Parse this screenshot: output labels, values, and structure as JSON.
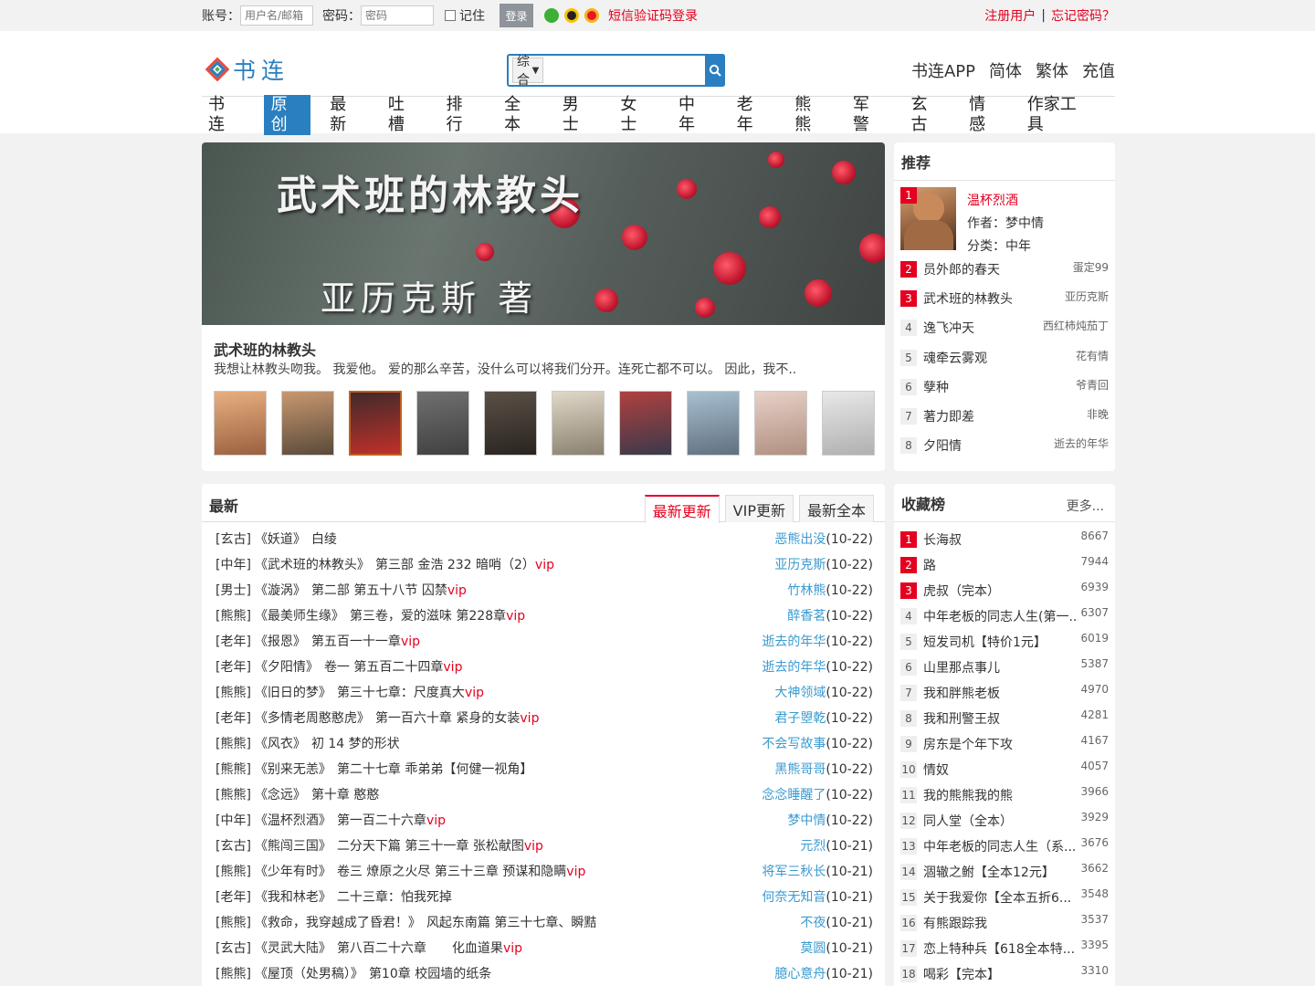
{
  "topbar": {
    "account_label": "账号：",
    "account_placeholder": "用户名/邮箱",
    "password_label": "密码：",
    "password_placeholder": "密码",
    "remember_label": "记住",
    "login_button": "登录",
    "sms_login": "短信验证码登录",
    "register": "注册用户",
    "separator": "|",
    "forgot": "忘记密码？"
  },
  "header": {
    "logo_text": "书连",
    "search_select": "综合",
    "links": [
      "书连APP",
      "简体",
      "繁体",
      "充值"
    ]
  },
  "nav": [
    "书连",
    "原创",
    "最新",
    "吐槽",
    "排行",
    "全本",
    "男士",
    "女士",
    "中年",
    "老年",
    "熊熊",
    "军警",
    "玄古",
    "情感",
    "作家工具"
  ],
  "nav_active": "原创",
  "banner": {
    "art_title": "武术班的林教头",
    "art_author": "亚历克斯 著",
    "title": "武术班的林教头",
    "desc": "我想让林教头吻我。 我爱他。 爱的那么辛苦，没什么可以将我们分开。连死亡都不可以。 因此，我不..",
    "thumb_names": [
      "温杯烈酒",
      "员外郎的春天",
      "武术班的林教头",
      "逸飞冲天",
      "魂牵云雾观",
      "孽种",
      "著力即差",
      "夕阳情",
      "cover-9",
      "cover-10"
    ]
  },
  "recommend": {
    "title": "推荐",
    "top": {
      "rank": "1",
      "title": "温杯烈酒",
      "author": "作者：梦中情",
      "category": "分类：中年"
    },
    "items": [
      {
        "rank": "2",
        "title": "员外郎的春天",
        "author": "蛋定99"
      },
      {
        "rank": "3",
        "title": "武术班的林教头",
        "author": "亚历克斯"
      },
      {
        "rank": "4",
        "title": "逸飞冲天",
        "author": "西红柿炖茄丁"
      },
      {
        "rank": "5",
        "title": "魂牵云雾观",
        "author": "花有情"
      },
      {
        "rank": "6",
        "title": "孽种",
        "author": "爷青回"
      },
      {
        "rank": "7",
        "title": "著力即差",
        "author": "非晚"
      },
      {
        "rank": "8",
        "title": "夕阳情",
        "author": "逝去的年华"
      }
    ]
  },
  "latest": {
    "title": "最新",
    "tabs": [
      "最新更新",
      "VIP更新",
      "最新全本"
    ],
    "rows": [
      {
        "cat": "[玄古]",
        "book": "《妖道》",
        "chapter": "白绫",
        "vip": "",
        "author": "恶熊出没",
        "date": "(10-22)"
      },
      {
        "cat": "[中年]",
        "book": "《武术班的林教头》",
        "chapter": "第三部 金浩 232 暗哨（2）",
        "vip": "vip",
        "author": "亚历克斯",
        "date": "(10-22)"
      },
      {
        "cat": "[男士]",
        "book": "《漩涡》",
        "chapter": "第二部 第五十八节 囚禁",
        "vip": "vip",
        "author": "竹林熊",
        "date": "(10-22)"
      },
      {
        "cat": "[熊熊]",
        "book": "《最美师生缘》",
        "chapter": "第三卷，爱的滋味 第228章",
        "vip": "vip",
        "author": "醉香茗",
        "date": "(10-22)"
      },
      {
        "cat": "[老年]",
        "book": "《报恩》",
        "chapter": "第五百一十一章",
        "vip": "vip",
        "author": "逝去的年华",
        "date": "(10-22)"
      },
      {
        "cat": "[老年]",
        "book": "《夕阳情》",
        "chapter": "卷一 第五百二十四章",
        "vip": "vip",
        "author": "逝去的年华",
        "date": "(10-22)"
      },
      {
        "cat": "[熊熊]",
        "book": "《旧日的梦》",
        "chapter": "第三十七章：尺度真大",
        "vip": "vip",
        "author": "大神领域",
        "date": "(10-22)"
      },
      {
        "cat": "[老年]",
        "book": "《多情老周憨憨虎》",
        "chapter": "第一百六十章 紧身的女装",
        "vip": "vip",
        "author": "君子曌乾",
        "date": "(10-22)"
      },
      {
        "cat": "[熊熊]",
        "book": "《风衣》",
        "chapter": "初 14 梦的形状",
        "vip": "",
        "author": "不会写故事",
        "date": "(10-22)"
      },
      {
        "cat": "[熊熊]",
        "book": "《别来无恙》",
        "chapter": "第二十七章 乖弟弟【何健一视角】",
        "vip": "",
        "author": "黑熊哥哥",
        "date": "(10-22)"
      },
      {
        "cat": "[熊熊]",
        "book": "《念远》",
        "chapter": "第十章 憨憨",
        "vip": "",
        "author": "念念睡醒了",
        "date": "(10-22)"
      },
      {
        "cat": "[中年]",
        "book": "《温杯烈酒》",
        "chapter": "第一百二十六章",
        "vip": "vip",
        "author": "梦中情",
        "date": "(10-22)"
      },
      {
        "cat": "[玄古]",
        "book": "《熊闯三国》",
        "chapter": "二分天下篇 第三十一章 张松献图",
        "vip": "vip",
        "author": "元烈",
        "date": "(10-21)"
      },
      {
        "cat": "[熊熊]",
        "book": "《少年有时》",
        "chapter": "卷三 燎原之火尽 第三十三章 预谋和隐瞒",
        "vip": "vip",
        "author": "将军三秋长",
        "date": "(10-21)"
      },
      {
        "cat": "[老年]",
        "book": "《我和林老》",
        "chapter": "二十三章：怕我死掉",
        "vip": "",
        "author": "何奈无知音",
        "date": "(10-21)"
      },
      {
        "cat": "[熊熊]",
        "book": "《救命，我穿越成了昏君！》",
        "chapter": "风起东南篇 第三十七章、瞬黠",
        "vip": "",
        "author": "不夜",
        "date": "(10-21)"
      },
      {
        "cat": "[玄古]",
        "book": "《灵武大陆》",
        "chapter": "第八百二十六章　　化血道果",
        "vip": "vip",
        "author": "莫圆",
        "date": "(10-21)"
      },
      {
        "cat": "[熊熊]",
        "book": "《屋顶（处男稿）》",
        "chapter": "第10章 校园墙的纸条",
        "vip": "",
        "author": "臆心意舟",
        "date": "(10-21)"
      }
    ]
  },
  "collect": {
    "title": "收藏榜",
    "more": "更多...",
    "items": [
      {
        "rank": "1",
        "title": "长海叔",
        "count": "8667"
      },
      {
        "rank": "2",
        "title": "路",
        "count": "7944"
      },
      {
        "rank": "3",
        "title": "虎叔（完本）",
        "count": "6939"
      },
      {
        "rank": "4",
        "title": "中年老板的同志人生(第一...",
        "count": "6307"
      },
      {
        "rank": "5",
        "title": "短发司机【特价1元】",
        "count": "6019"
      },
      {
        "rank": "6",
        "title": "山里那点事儿",
        "count": "5387"
      },
      {
        "rank": "7",
        "title": "我和胖熊老板",
        "count": "4970"
      },
      {
        "rank": "8",
        "title": "我和刑警王叔",
        "count": "4281"
      },
      {
        "rank": "9",
        "title": "房东是个年下攻",
        "count": "4167"
      },
      {
        "rank": "10",
        "title": "情奴",
        "count": "4057"
      },
      {
        "rank": "11",
        "title": "我的熊熊我的熊",
        "count": "3966"
      },
      {
        "rank": "12",
        "title": "同人堂（全本）",
        "count": "3929"
      },
      {
        "rank": "13",
        "title": "中年老板的同志人生（系...",
        "count": "3676"
      },
      {
        "rank": "14",
        "title": "涸辙之鲋【全本12元】",
        "count": "3662"
      },
      {
        "rank": "15",
        "title": "关于我爱你【全本五折6...",
        "count": "3548"
      },
      {
        "rank": "16",
        "title": "有熊跟踪我",
        "count": "3537"
      },
      {
        "rank": "17",
        "title": "恋上特种兵【618全本特...",
        "count": "3395"
      },
      {
        "rank": "18",
        "title": "喝彩【完本】",
        "count": "3310"
      }
    ]
  },
  "colors": {
    "accent": "#2a7fc0",
    "red": "#e5001f",
    "author_link": "#3a9ad0"
  }
}
